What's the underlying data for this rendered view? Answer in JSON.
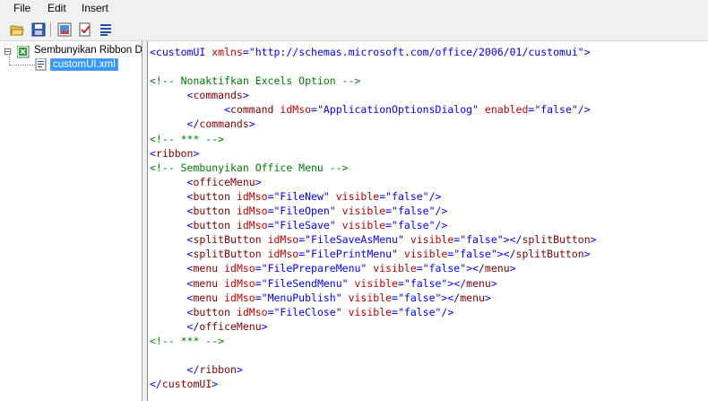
{
  "menubar": {
    "items": [
      "File",
      "Edit",
      "Insert"
    ]
  },
  "toolbar": {
    "buttons": [
      {
        "icon": "open-folder-icon"
      },
      {
        "icon": "save-icon"
      },
      {
        "icon": "insert-icons-icon"
      },
      {
        "icon": "validate-icon"
      },
      {
        "icon": "generate-callbacks-icon"
      }
    ]
  },
  "tree": {
    "root_label": "Sembunyikan Ribbon Dan",
    "child_label": "customUI.xml",
    "expander": "⊟"
  },
  "editor": {
    "lines": [
      [
        [
          "b",
          "<customUI "
        ],
        [
          "r",
          "xmlns"
        ],
        [
          "b",
          "=\""
        ],
        [
          "b",
          "http://schemas.microsoft.com/office/2006/01/customui"
        ],
        [
          "b",
          "\">"
        ]
      ],
      [],
      [
        [
          "g",
          "<!-- Nonaktifkan Excels Option -->"
        ]
      ],
      [
        [
          "b",
          "      <"
        ],
        [
          "m",
          "commands"
        ],
        [
          "b",
          ">"
        ]
      ],
      [
        [
          "b",
          "            <"
        ],
        [
          "m",
          "command "
        ],
        [
          "r",
          "idMso"
        ],
        [
          "b",
          "=\""
        ],
        [
          "b",
          "ApplicationOptionsDialog"
        ],
        [
          "b",
          "\" "
        ],
        [
          "r",
          "enabled"
        ],
        [
          "b",
          "=\""
        ],
        [
          "b",
          "false"
        ],
        [
          "b",
          "\"/>"
        ]
      ],
      [
        [
          "b",
          "      </"
        ],
        [
          "m",
          "commands"
        ],
        [
          "b",
          ">"
        ]
      ],
      [
        [
          "g",
          "<!-- *** -->"
        ]
      ],
      [
        [
          "b",
          "<"
        ],
        [
          "m",
          "ribbon"
        ],
        [
          "b",
          ">"
        ]
      ],
      [
        [
          "g",
          "<!-- Sembunyikan Office Menu -->"
        ]
      ],
      [
        [
          "b",
          "      <"
        ],
        [
          "m",
          "officeMenu"
        ],
        [
          "b",
          ">"
        ]
      ],
      [
        [
          "b",
          "      <"
        ],
        [
          "m",
          "button "
        ],
        [
          "r",
          "idMso"
        ],
        [
          "b",
          "=\"FileNew\" "
        ],
        [
          "r",
          "visible"
        ],
        [
          "b",
          "=\"false\"/>"
        ]
      ],
      [
        [
          "b",
          "      <"
        ],
        [
          "m",
          "button "
        ],
        [
          "r",
          "idMso"
        ],
        [
          "b",
          "=\"FileOpen\" "
        ],
        [
          "r",
          "visible"
        ],
        [
          "b",
          "=\"false\"/>"
        ]
      ],
      [
        [
          "b",
          "      <"
        ],
        [
          "m",
          "button "
        ],
        [
          "r",
          "idMso"
        ],
        [
          "b",
          "=\"FileSave\" "
        ],
        [
          "r",
          "visible"
        ],
        [
          "b",
          "=\"false\"/>"
        ]
      ],
      [
        [
          "b",
          "      <"
        ],
        [
          "m",
          "splitButton "
        ],
        [
          "r",
          "idMso"
        ],
        [
          "b",
          "=\"FileSaveAsMenu\" "
        ],
        [
          "r",
          "visible"
        ],
        [
          "b",
          "=\"false\"></"
        ],
        [
          "m",
          "splitButton"
        ],
        [
          "b",
          ">"
        ]
      ],
      [
        [
          "b",
          "      <"
        ],
        [
          "m",
          "splitButton "
        ],
        [
          "r",
          "idMso"
        ],
        [
          "b",
          "=\"FilePrintMenu\" "
        ],
        [
          "r",
          "visible"
        ],
        [
          "b",
          "=\"false\"></"
        ],
        [
          "m",
          "splitButton"
        ],
        [
          "b",
          ">"
        ]
      ],
      [
        [
          "b",
          "      <"
        ],
        [
          "m",
          "menu "
        ],
        [
          "r",
          "idMso"
        ],
        [
          "b",
          "=\"FilePrepareMenu\" "
        ],
        [
          "r",
          "visible"
        ],
        [
          "b",
          "=\"false\"></"
        ],
        [
          "m",
          "menu"
        ],
        [
          "b",
          ">"
        ]
      ],
      [
        [
          "b",
          "      <"
        ],
        [
          "m",
          "menu "
        ],
        [
          "r",
          "idMso"
        ],
        [
          "b",
          "=\"FileSendMenu\" "
        ],
        [
          "r",
          "visible"
        ],
        [
          "b",
          "=\"false\"></"
        ],
        [
          "m",
          "menu"
        ],
        [
          "b",
          ">"
        ]
      ],
      [
        [
          "b",
          "      <"
        ],
        [
          "m",
          "menu "
        ],
        [
          "r",
          "idMso"
        ],
        [
          "b",
          "=\"MenuPublish\" "
        ],
        [
          "r",
          "visible"
        ],
        [
          "b",
          "=\"false\"></"
        ],
        [
          "m",
          "menu"
        ],
        [
          "b",
          ">"
        ]
      ],
      [
        [
          "b",
          "      <"
        ],
        [
          "m",
          "button "
        ],
        [
          "r",
          "idMso"
        ],
        [
          "b",
          "=\"FileClose\" "
        ],
        [
          "r",
          "visible"
        ],
        [
          "b",
          "=\"false\"/>"
        ]
      ],
      [
        [
          "b",
          "      </"
        ],
        [
          "m",
          "officeMenu"
        ],
        [
          "b",
          ">"
        ]
      ],
      [
        [
          "g",
          "<!-- *** -->"
        ]
      ],
      [],
      [
        [
          "b",
          "      </"
        ],
        [
          "m",
          "ribbon"
        ],
        [
          "b",
          ">"
        ]
      ],
      [
        [
          "b",
          "</"
        ],
        [
          "m",
          "customUI"
        ],
        [
          "b",
          ">"
        ]
      ]
    ]
  }
}
